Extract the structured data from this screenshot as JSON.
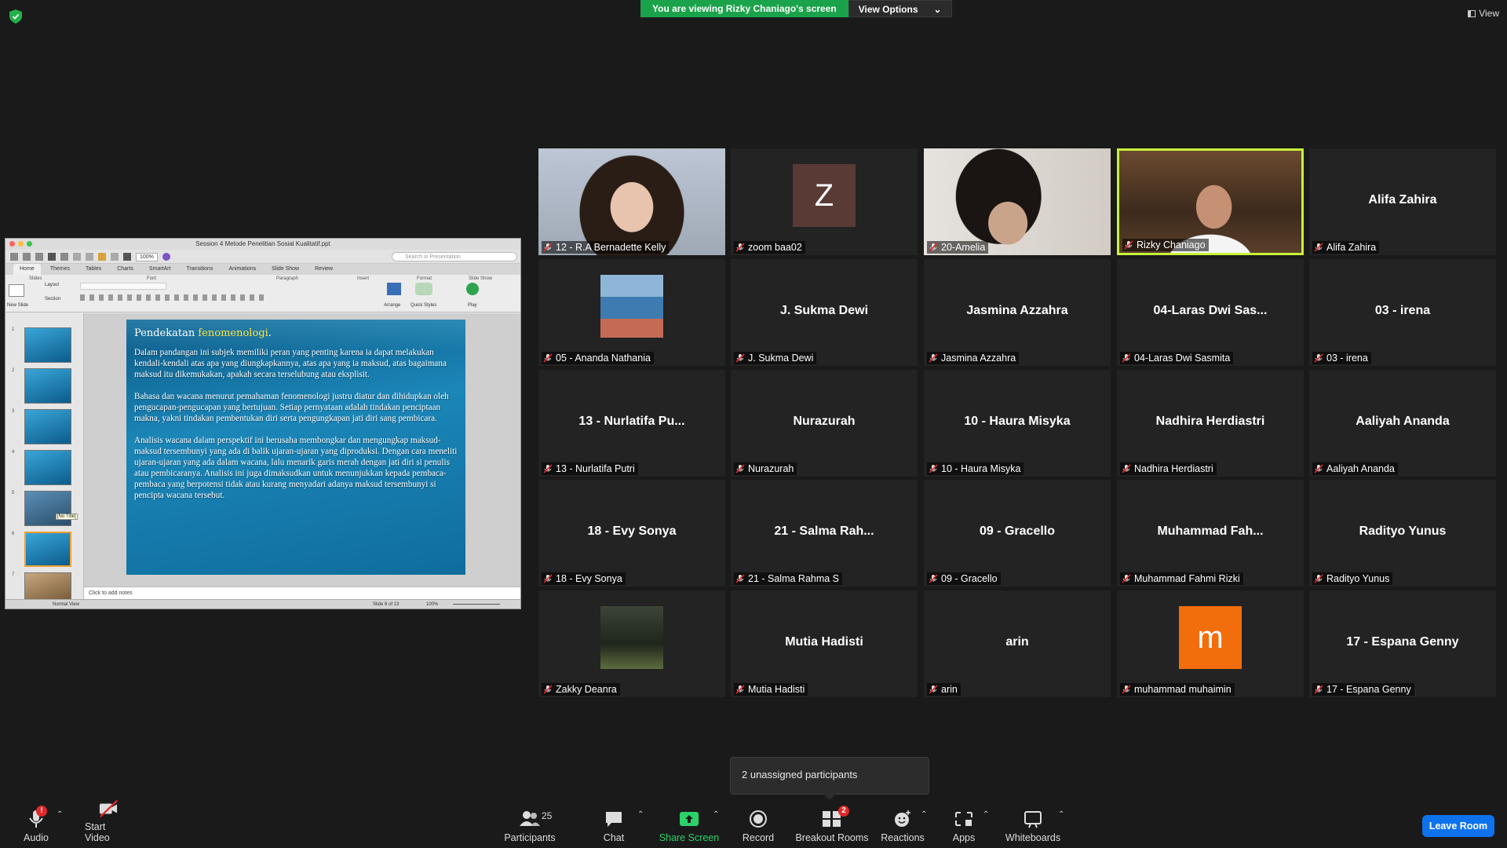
{
  "top": {
    "banner": "You are viewing Rizky Chaniago's screen",
    "view_options": "View Options",
    "view": "View"
  },
  "ppt": {
    "window_title": "Session 4 Metode Penelitian Sosial Kualitatif.ppt",
    "search_placeholder": "Search in Presentation",
    "zoom": "100%",
    "tabs": [
      "Home",
      "Themes",
      "Tables",
      "Charts",
      "SmartArt",
      "Transitions",
      "Animations",
      "Slide Show",
      "Review"
    ],
    "ribbon_groups": [
      "Slides",
      "Font",
      "Paragraph",
      "Insert",
      "Format",
      "Slide Show"
    ],
    "ribbon_buttons": [
      "New Slide",
      "Layout",
      "Section",
      "Arrange",
      "Quick Styles",
      "Play"
    ],
    "thumb_numbers": [
      "1",
      "2",
      "3",
      "4",
      "5",
      "6",
      "7"
    ],
    "thumb_tooltip": "[No Title]",
    "slide": {
      "title_prefix": "Pendekatan ",
      "title_highlight": "fenomenologi",
      "title_suffix": ".",
      "paragraphs": [
        "Dalam pandangan ini subjek memiliki peran yang penting karena ia dapat melakukan kendali-kendali atas apa yang diungkapkannya, atas apa yang ia maksud, atas bagaimana maksud itu dikemukakan, apakah secara terselubung atau eksplisit.",
        "Bahasa dan wacana menurut pemahaman fenomenologi justru diatur dan dihidupkan oleh pengucapan-pengucapan yang bertujuan. Setiap pernyataan adalah tindakan penciptaan makna, yakni tindakan pembentukan diri serta pengungkapan jati diri sang pembicara.",
        "Analisis wacana dalam perspektif ini berusaha membongkar dan mengungkap maksud-maksud tersembunyi yang ada di balik ujaran-ujaran yang diproduksi. Dengan cara meneliti ujaran-ujaran yang ada dalam wacana, lalu menarik garis merah dengan jati diri si penulis atau pembicaranya. Analisis ini juga dimaksudkan untuk menunjukkan kepada pembaca-pembaca yang berpotensi tidak atau kurang menyadari adanya maksud tersembunyi si pencipta wacana tersebut."
      ]
    },
    "notes": "Click to add notes",
    "status_view": "Normal View",
    "status_slide": "Slide 6 of 13",
    "status_zoom": "100%"
  },
  "participants": [
    {
      "big": "",
      "label": "12 - R.A Bernadette Kelly",
      "kind": "video1"
    },
    {
      "big": "",
      "label": "zoom baa02",
      "kind": "avatar",
      "letter": "Z",
      "color": "#5a3a35"
    },
    {
      "big": "",
      "label": "20-Amelia",
      "kind": "video2"
    },
    {
      "big": "",
      "label": "Rizky Chaniago",
      "kind": "video3",
      "active": true
    },
    {
      "big": "Alifa Zahira",
      "label": "Alifa Zahira"
    },
    {
      "big": "",
      "label": "05 - Ananda Nathania",
      "kind": "pic1"
    },
    {
      "big": "J. Sukma Dewi",
      "label": "J. Sukma Dewi"
    },
    {
      "big": "Jasmina Azzahra",
      "label": "Jasmina Azzahra"
    },
    {
      "big": "04-Laras Dwi Sas...",
      "label": "04-Laras Dwi Sasmita"
    },
    {
      "big": "03 - irena",
      "label": "03 - irena"
    },
    {
      "big": "13 - Nurlatifa Pu...",
      "label": "13 - Nurlatifa Putri"
    },
    {
      "big": "Nurazurah",
      "label": "Nurazurah"
    },
    {
      "big": "10 - Haura Misyka",
      "label": "10 - Haura Misyka"
    },
    {
      "big": "Nadhira Herdiastri",
      "label": "Nadhira Herdiastri"
    },
    {
      "big": "Aaliyah Ananda",
      "label": "Aaliyah Ananda"
    },
    {
      "big": "18 - Evy Sonya",
      "label": "18 - Evy Sonya"
    },
    {
      "big": "21 - Salma Rah...",
      "label": "21 - Salma Rahma S"
    },
    {
      "big": "09 - Gracello",
      "label": "09 - Gracello"
    },
    {
      "big": "Muhammad  Fah...",
      "label": "Muhammad Fahmi Rizki"
    },
    {
      "big": "Radityo Yunus",
      "label": "Radityo Yunus"
    },
    {
      "big": "",
      "label": "Zakky Deanra",
      "kind": "pic2"
    },
    {
      "big": "Mutia Hadisti",
      "label": "Mutia Hadisti"
    },
    {
      "big": "arin",
      "label": "arin"
    },
    {
      "big": "",
      "label": "muhammad muhaimin",
      "kind": "avatar",
      "letter": "m",
      "color": "#f26d0c"
    },
    {
      "big": "17 - Espana Genny",
      "label": "17 - Espana Genny"
    }
  ],
  "tooltip": "2 unassigned participants",
  "toolbar": {
    "audio": "Audio",
    "audio_badge": "!",
    "video": "Start Video",
    "participants": "Participants",
    "participants_count": "25",
    "chat": "Chat",
    "share": "Share Screen",
    "record": "Record",
    "breakout": "Breakout Rooms",
    "breakout_badge": "2",
    "reactions": "Reactions",
    "apps": "Apps",
    "whiteboards": "Whiteboards",
    "leave": "Leave Room"
  }
}
